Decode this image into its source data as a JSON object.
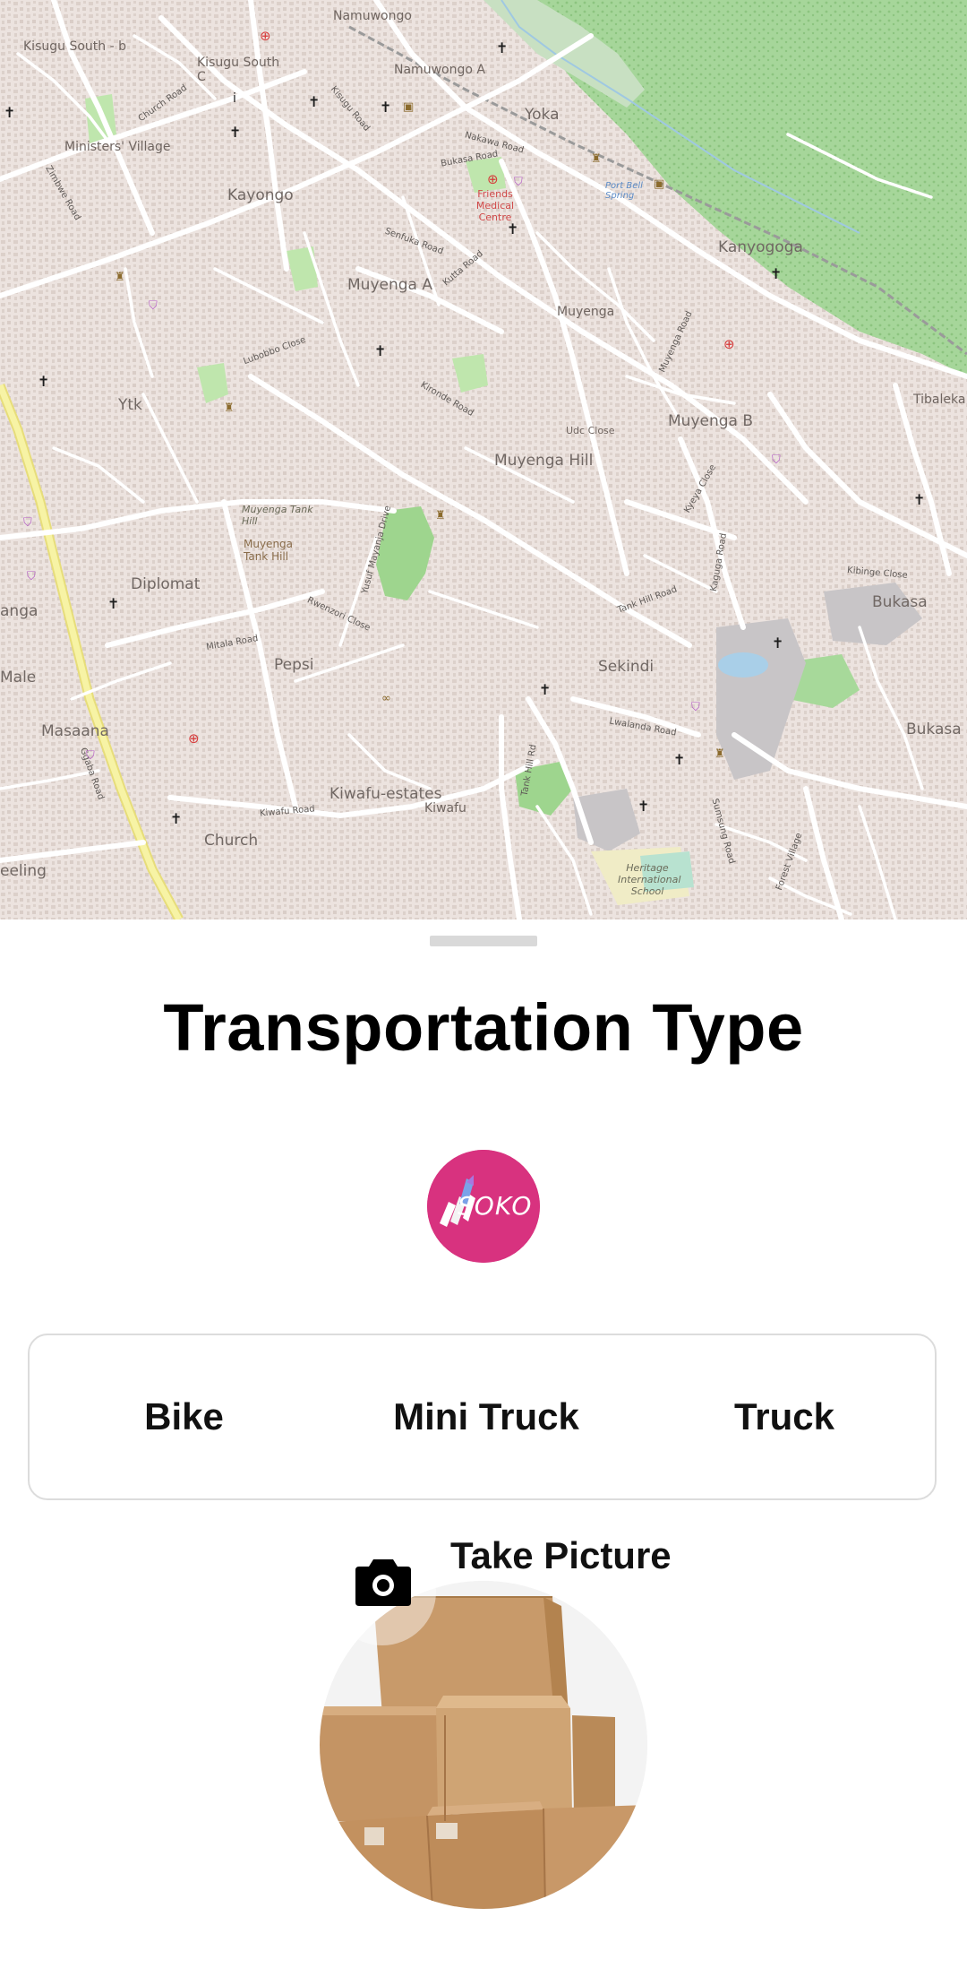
{
  "map": {
    "area_labels": [
      "Kisugu South - b",
      "Kisugu South C",
      "Namuwongo",
      "Namuwongo A",
      "Yoka",
      "Ministers' Village",
      "Kayongo",
      "Muyenga A",
      "Muyenga",
      "Kanyogoga",
      "Tibaleka",
      "Ytk",
      "Muyenga B",
      "Muyenga Hill",
      "Muyenga Tank Hill",
      "Diplomat",
      "Bukasa",
      "Pepsi",
      "Sekindi",
      "Masaana",
      "Kiwafu-estates",
      "Kiwafu",
      "Church",
      "Udc Close",
      "Male",
      "anga",
      "eeling"
    ],
    "poi_labels": {
      "hospital": "Friends Medical Centre",
      "spring": "Port Bell Spring",
      "school": "Heritage International School",
      "tank": "Muyenga Tank Hill"
    },
    "road_labels": [
      "Church Road",
      "Bukasa Road",
      "Nakawa Road",
      "Zimbwe Road",
      "Kisugu Road",
      "Senfuka Road",
      "Kutta Road",
      "Lubobbo Close",
      "Muyenga Road",
      "Tank Hill Road",
      "Lwalanda Road",
      "Kiwafu Road",
      "Mitala Road",
      "Rwenzori Close",
      "Yusuf Mayanja Drive",
      "Ggaba Road",
      "Sumsung Road",
      "Kyeya Close",
      "Kaguga Road",
      "Kibinge Close",
      "Forest Village",
      "Kironde Road",
      "Tank Hill Rd"
    ]
  },
  "sheet": {
    "title": "Transportation Type",
    "logo": {
      "text": "SOKO",
      "icon": "soko-logo-icon",
      "color": "#d8327f"
    },
    "options": [
      {
        "label": "Bike"
      },
      {
        "label": "Mini Truck"
      },
      {
        "label": "Truck"
      }
    ],
    "take_picture_label": "Take Picture",
    "camera_icon": "camera-icon",
    "photo_icon": "cardboard-boxes-image"
  },
  "colors": {
    "map_background": "#efe7e3",
    "map_accent_line": "#e1447f",
    "park_green": "#8fd08a",
    "ggaba_road_yellow": "#f5f08f",
    "brand_pink": "#d8327f"
  }
}
